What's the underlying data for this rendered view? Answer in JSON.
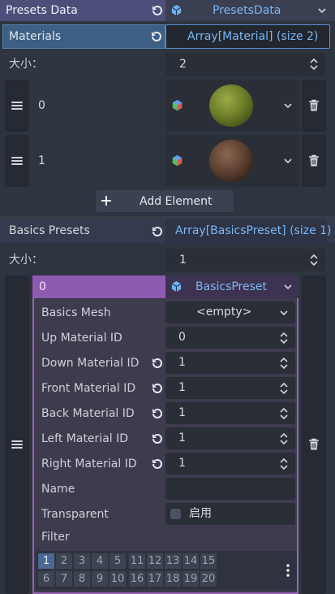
{
  "presets": {
    "label": "Presets Data",
    "value": "PresetsData"
  },
  "materials": {
    "label": "Materials",
    "value": "Array[Material] (size 2)",
    "size_label": "大小：",
    "size": "2",
    "items": [
      {
        "index": "0",
        "color": "#7a8a2e"
      },
      {
        "index": "1",
        "color": "#6b4a36"
      }
    ],
    "add_label": "Add Element"
  },
  "basics": {
    "label": "Basics Presets",
    "value": "Array[BasicsPreset] (size 1)",
    "size_label": "大小：",
    "size": "1",
    "element": {
      "index": "0",
      "type": "BasicsPreset",
      "mesh": {
        "label": "Basics Mesh",
        "value": "<empty>"
      },
      "up": {
        "label": "Up Material ID",
        "value": "0"
      },
      "down": {
        "label": "Down Material ID",
        "value": "1"
      },
      "front": {
        "label": "Front Material ID",
        "value": "1"
      },
      "back": {
        "label": "Back Material ID",
        "value": "1"
      },
      "left": {
        "label": "Left Material ID",
        "value": "1"
      },
      "right": {
        "label": "Right Material ID",
        "value": "1"
      },
      "name": {
        "label": "Name",
        "value": ""
      },
      "transparent": {
        "label": "Transparent",
        "checkbox_label": "启用",
        "checked": false
      },
      "filter": {
        "label": "Filter",
        "active": "1",
        "row1": [
          "1",
          "2",
          "3",
          "4",
          "5",
          "11",
          "12",
          "13",
          "14",
          "15"
        ],
        "row2": [
          "6",
          "7",
          "8",
          "9",
          "10",
          "16",
          "17",
          "18",
          "19",
          "20"
        ]
      }
    }
  }
}
